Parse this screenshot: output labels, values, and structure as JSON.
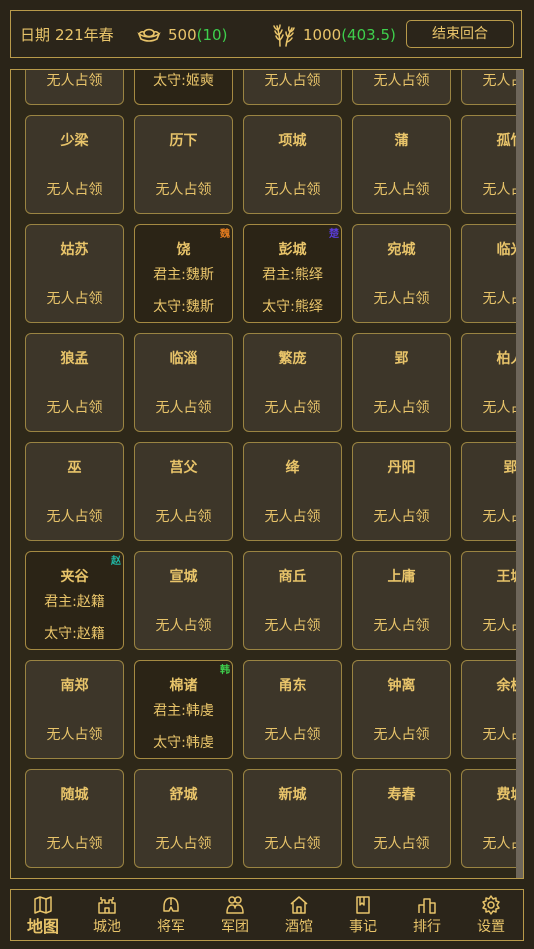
{
  "header": {
    "date_label": "日期",
    "date_value": "221年春",
    "gold_icon": "gold-ingot-icon",
    "gold_value": "500",
    "gold_income": "(10)",
    "grain_icon": "wheat-icon",
    "grain_value": "1000",
    "grain_income": "(403.5)",
    "end_turn_label": "结束回合"
  },
  "colors": {
    "gold_text": "#e8c46a",
    "income_green": "#3ecf4c",
    "wei_badge": "#e07a1f",
    "chu_badge": "#5a3cd8",
    "zhao_badge": "#21b7a4",
    "han_badge": "#3ecf4c"
  },
  "map": {
    "rows": [
      [
        {
          "name": "",
          "l1": "",
          "l2": "无人占领"
        },
        {
          "name": "",
          "l1": "",
          "l2": "太守:姬奭",
          "occupied": true
        },
        {
          "name": "",
          "l1": "",
          "l2": "无人占领"
        },
        {
          "name": "",
          "l1": "",
          "l2": "无人占领"
        },
        {
          "name": "",
          "l1": "",
          "l2": "无人占领"
        }
      ],
      [
        {
          "name": "少梁",
          "l1": "",
          "l2": "无人占领"
        },
        {
          "name": "历下",
          "l1": "",
          "l2": "无人占领"
        },
        {
          "name": "项城",
          "l1": "",
          "l2": "无人占领"
        },
        {
          "name": "蒲",
          "l1": "",
          "l2": "无人占领"
        },
        {
          "name": "孤竹",
          "l1": "",
          "l2": "无人占领"
        }
      ],
      [
        {
          "name": "姑苏",
          "l1": "",
          "l2": "无人占领"
        },
        {
          "name": "饶",
          "l1": "君主:魏斯",
          "l2": "太守:魏斯",
          "occupied": true,
          "badge": "魏",
          "badge_color": "#e07a1f"
        },
        {
          "name": "彭城",
          "l1": "君主:熊绎",
          "l2": "太守:熊绎",
          "occupied": true,
          "badge": "楚",
          "badge_color": "#5a3cd8"
        },
        {
          "name": "宛城",
          "l1": "",
          "l2": "无人占领"
        },
        {
          "name": "临光",
          "l1": "",
          "l2": "无人占领"
        }
      ],
      [
        {
          "name": "狼孟",
          "l1": "",
          "l2": "无人占领"
        },
        {
          "name": "临淄",
          "l1": "",
          "l2": "无人占领"
        },
        {
          "name": "繁庞",
          "l1": "",
          "l2": "无人占领"
        },
        {
          "name": "郢",
          "l1": "",
          "l2": "无人占领"
        },
        {
          "name": "柏人",
          "l1": "",
          "l2": "无人占领"
        }
      ],
      [
        {
          "name": "巫",
          "l1": "",
          "l2": "无人占领"
        },
        {
          "name": "莒父",
          "l1": "",
          "l2": "无人占领"
        },
        {
          "name": "绛",
          "l1": "",
          "l2": "无人占领"
        },
        {
          "name": "丹阳",
          "l1": "",
          "l2": "无人占领"
        },
        {
          "name": "郢",
          "l1": "",
          "l2": "无人占领"
        }
      ],
      [
        {
          "name": "夹谷",
          "l1": "君主:赵籍",
          "l2": "太守:赵籍",
          "occupied": true,
          "badge": "赵",
          "badge_color": "#21b7a4"
        },
        {
          "name": "宣城",
          "l1": "",
          "l2": "无人占领"
        },
        {
          "name": "商丘",
          "l1": "",
          "l2": "无人占领"
        },
        {
          "name": "上庸",
          "l1": "",
          "l2": "无人占领"
        },
        {
          "name": "王城",
          "l1": "",
          "l2": "无人占领"
        }
      ],
      [
        {
          "name": "南郑",
          "l1": "",
          "l2": "无人占领"
        },
        {
          "name": "棉诸",
          "l1": "君主:韩虔",
          "l2": "太守:韩虔",
          "occupied": true,
          "badge": "韩",
          "badge_color": "#3ecf4c"
        },
        {
          "name": "甬东",
          "l1": "",
          "l2": "无人占领"
        },
        {
          "name": "钟离",
          "l1": "",
          "l2": "无人占领"
        },
        {
          "name": "余杭",
          "l1": "",
          "l2": "无人占领"
        }
      ],
      [
        {
          "name": "随城",
          "l1": "",
          "l2": "无人占领"
        },
        {
          "name": "舒城",
          "l1": "",
          "l2": "无人占领"
        },
        {
          "name": "新城",
          "l1": "",
          "l2": "无人占领"
        },
        {
          "name": "寿春",
          "l1": "",
          "l2": "无人占领"
        },
        {
          "name": "费城",
          "l1": "",
          "l2": "无人占领"
        }
      ]
    ]
  },
  "nav": [
    {
      "label": "地图",
      "icon": "map-icon",
      "active": true
    },
    {
      "label": "城池",
      "icon": "city-icon"
    },
    {
      "label": "将军",
      "icon": "helmet-icon"
    },
    {
      "label": "军团",
      "icon": "army-icon"
    },
    {
      "label": "酒馆",
      "icon": "tavern-icon"
    },
    {
      "label": "事记",
      "icon": "notebook-icon"
    },
    {
      "label": "排行",
      "icon": "ranking-icon"
    },
    {
      "label": "设置",
      "icon": "gear-icon"
    }
  ]
}
